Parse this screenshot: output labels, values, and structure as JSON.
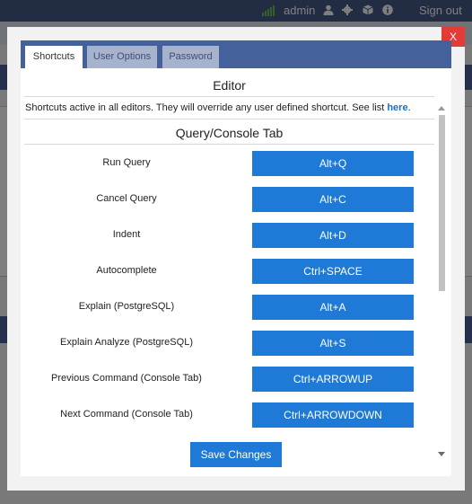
{
  "topbar": {
    "username": "admin",
    "signout_label": "Sign out",
    "icons": [
      "signal-icon",
      "user-icon",
      "gear-icon",
      "cube-icon",
      "info-icon"
    ]
  },
  "modal": {
    "close_label": "X",
    "tabs": [
      {
        "label": "Shortcuts",
        "active": true
      },
      {
        "label": "User Options",
        "active": false
      },
      {
        "label": "Password",
        "active": false
      }
    ],
    "editor_title": "Editor",
    "info_text": "Shortcuts active in all editors. They will override any user defined shortcut. See list ",
    "info_link": "here",
    "info_suffix": ".",
    "section_title": "Query/Console Tab",
    "shortcuts": [
      {
        "label": "Run Query",
        "key": "Alt+Q"
      },
      {
        "label": "Cancel Query",
        "key": "Alt+C"
      },
      {
        "label": "Indent",
        "key": "Alt+D"
      },
      {
        "label": "Autocomplete",
        "key": "Ctrl+SPACE"
      },
      {
        "label": "Explain (PostgreSQL)",
        "key": "Alt+A"
      },
      {
        "label": "Explain Analyze (PostgreSQL)",
        "key": "Alt+S"
      },
      {
        "label": "Previous Command (Console Tab)",
        "key": "Ctrl+ARROWUP"
      },
      {
        "label": "Next Command (Console Tab)",
        "key": "Ctrl+ARROWDOWN"
      }
    ],
    "save_label": "Save Changes"
  },
  "colors": {
    "topbar": "#455a86",
    "tabbar": "#44619b",
    "button": "#1e7ad6",
    "close": "#e33b38",
    "link": "#1b6fc7"
  }
}
